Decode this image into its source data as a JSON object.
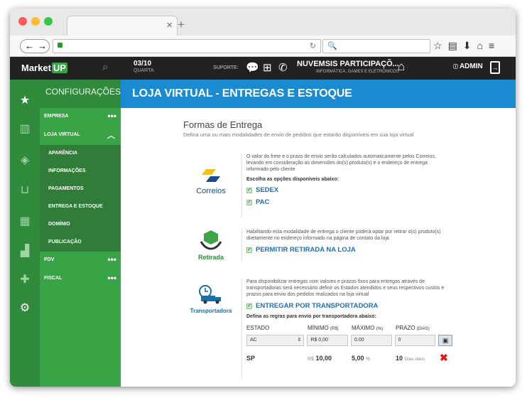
{
  "browser": {
    "tab_close": "×",
    "new_tab": "+",
    "nav_back_forward": "←|→",
    "search_glyph": "🔍"
  },
  "appbar": {
    "logo_prefix": "Market",
    "logo_suffix": "UP",
    "date": "03/10",
    "weekday": "QUARTA",
    "support_label": "SUPORTE:",
    "company_name": "NUVEMSIS PARTICIPAÇÕ...",
    "company_sub": "INFORMÁTICA, GAMES E ELETRÔNICOS",
    "user": "ADMIN"
  },
  "sidebar": {
    "heading": "CONFIGURAÇÕES",
    "items": [
      {
        "label": "EMPRESA",
        "more": "•••"
      },
      {
        "label": "LOJA VIRTUAL",
        "more": "︿"
      }
    ],
    "sub_items": [
      {
        "label": "APARÊNCIA"
      },
      {
        "label": "INFORMAÇÕES"
      },
      {
        "label": "PAGAMENTOS"
      },
      {
        "label": "ENTREGA E ESTOQUE"
      },
      {
        "label": "DOMÍNIO"
      },
      {
        "label": "PUBLICAÇÃO"
      }
    ],
    "bottom_items": [
      {
        "label": "PDV",
        "more": "•••"
      },
      {
        "label": "FISCAL",
        "more": "•••"
      }
    ]
  },
  "page": {
    "banner": "LOJA VIRTUAL - ENTREGAS E ESTOQUE",
    "section_title": "Formas de Entrega",
    "section_sub": "Defina uma ou mais modalidades de envio de pedidos que estarão disponíveis em sua loja virtual"
  },
  "correios": {
    "brand": "Correios",
    "desc": "O valor do frete e o prazo de envio serão calculados automaticamente pelos Correios, levando em consideração as dimensões do(s) produto(s) e o endereço de entrega informado pelo cliente",
    "choose_label": "Escolha as opções disponíveis abaixo:",
    "options": [
      "SEDEX",
      "PAC"
    ]
  },
  "retirada": {
    "brand": "Retirada",
    "desc": "Habilitando esta modalidade de entrega o cliente poderá optar por retirar o(s) produto(s) diretamente no endereço informado na página de contato da loja",
    "option": "PERMITIR RETIRADA NA LOJA"
  },
  "transportadora": {
    "brand": "Transportadora",
    "desc": "Para disponibilizar entregas com valores e prazos fixos para entregas através de transportadoras será necessário definir os Estados atendidos e seus respectivos custos e prazos para envio dos pedidos realizados na loja virtual",
    "option": "ENTREGAR POR TRANSPORTADORA",
    "rules_label": "Defina as regras para envio por transportadora abaixo:",
    "headers": {
      "estado": "ESTADO",
      "minimo": "MÍNIMO",
      "minimo_unit": "(R$)",
      "maximo": "MÁXIMO",
      "maximo_unit": "(%)",
      "prazo": "PRAZO",
      "prazo_unit": "(DIAS)"
    },
    "input_row": {
      "estado": "AC",
      "minimo": "R$ 0,00",
      "maximo": "0.00",
      "prazo": "0"
    },
    "rows": [
      {
        "estado": "SP",
        "minimo_prefix": "R$",
        "minimo": "10,00",
        "maximo": "5,00",
        "maximo_unit": "%",
        "prazo": "10",
        "prazo_unit": "Dias úteis"
      }
    ]
  }
}
